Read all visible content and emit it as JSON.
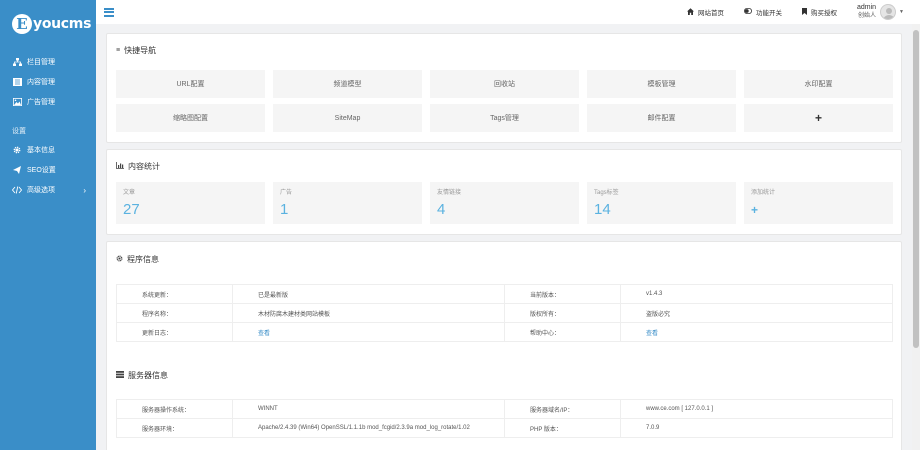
{
  "brand": {
    "logo_letter": "E",
    "logo_text": "youcms"
  },
  "sidebar": {
    "items": [
      {
        "label": "栏目管理",
        "icon": "sitemap-icon"
      },
      {
        "label": "内容管理",
        "icon": "list-icon"
      },
      {
        "label": "广告管理",
        "icon": "image-icon"
      }
    ],
    "section_label": "设置",
    "settings": [
      {
        "label": "基本信息",
        "icon": "gear-icon"
      },
      {
        "label": "SEO设置",
        "icon": "paper-plane-icon"
      },
      {
        "label": "高级选项",
        "icon": "code-icon"
      }
    ]
  },
  "header": {
    "links": [
      {
        "label": "网站首页",
        "icon": "home-icon"
      },
      {
        "label": "功能开关",
        "icon": "toggle-icon"
      },
      {
        "label": "购买授权",
        "icon": "bookmark-icon"
      }
    ],
    "user_name": "admin",
    "user_role": "创始人"
  },
  "quicknav": {
    "title": "快捷导航",
    "buttons": [
      "URL配置",
      "频道模型",
      "回收站",
      "模板管理",
      "水印配置",
      "缩略图配置",
      "SiteMap",
      "Tags管理",
      "邮件配置",
      "+"
    ]
  },
  "stats": {
    "title": "内容统计",
    "items": [
      {
        "label": "文章",
        "value": "27"
      },
      {
        "label": "广告",
        "value": "1"
      },
      {
        "label": "友情链接",
        "value": "4"
      },
      {
        "label": "Tags标签",
        "value": "14"
      },
      {
        "label": "添加统计",
        "value": "+"
      }
    ]
  },
  "program": {
    "title": "程序信息",
    "rows": [
      [
        "系统更新：",
        "已是最新版",
        "当前版本：",
        "v1.4.3"
      ],
      [
        "程序名称：",
        "木材防腐木建材类网站模板",
        "版权所有：",
        "盗版必究"
      ],
      [
        "更新日志：",
        "查看",
        "帮助中心：",
        "查看"
      ]
    ]
  },
  "server": {
    "title": "服务器信息",
    "rows": [
      [
        "服务器操作系统：",
        "WINNT",
        "服务器域名/IP：",
        "www.ce.com [ 127.0.0.1 ]"
      ],
      [
        "服务器环境：",
        "Apache/2.4.39 (Win64) OpenSSL/1.1.1b mod_fcgid/2.3.9a mod_log_rotate/1.02",
        "PHP 版本：",
        "7.0.9"
      ]
    ]
  },
  "colors": {
    "sidebar": "#3a8ec8",
    "accent": "#5ab2e0",
    "background": "#f1f2f4"
  }
}
